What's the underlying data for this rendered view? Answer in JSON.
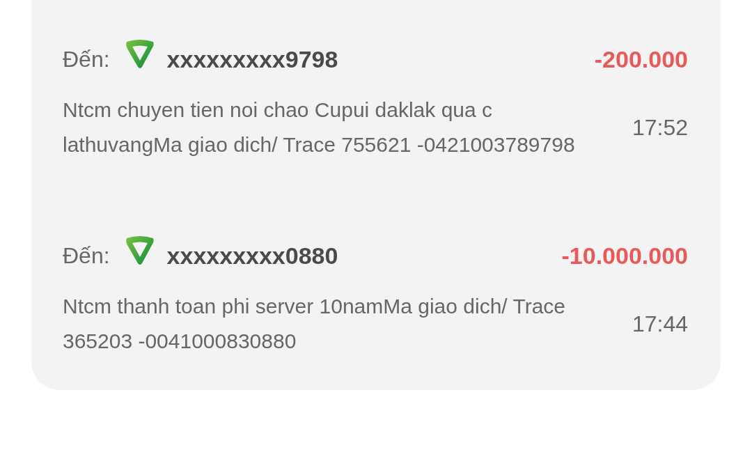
{
  "transactions": [
    {
      "label": "Đến:",
      "account": "xxxxxxxxx9798",
      "amount": "-200.000",
      "description": "Ntcm chuyen tien noi chao Cupui daklak qua c lathuvangMa giao dich/ Trace 755621 -0421003789798",
      "time": "17:52"
    },
    {
      "label": "Đến:",
      "account": "xxxxxxxxx0880",
      "amount": "-10.000.000",
      "description": "Ntcm thanh toan phi server 10namMa giao dich/ Trace 365203 -0041000830880",
      "time": "17:44"
    }
  ]
}
